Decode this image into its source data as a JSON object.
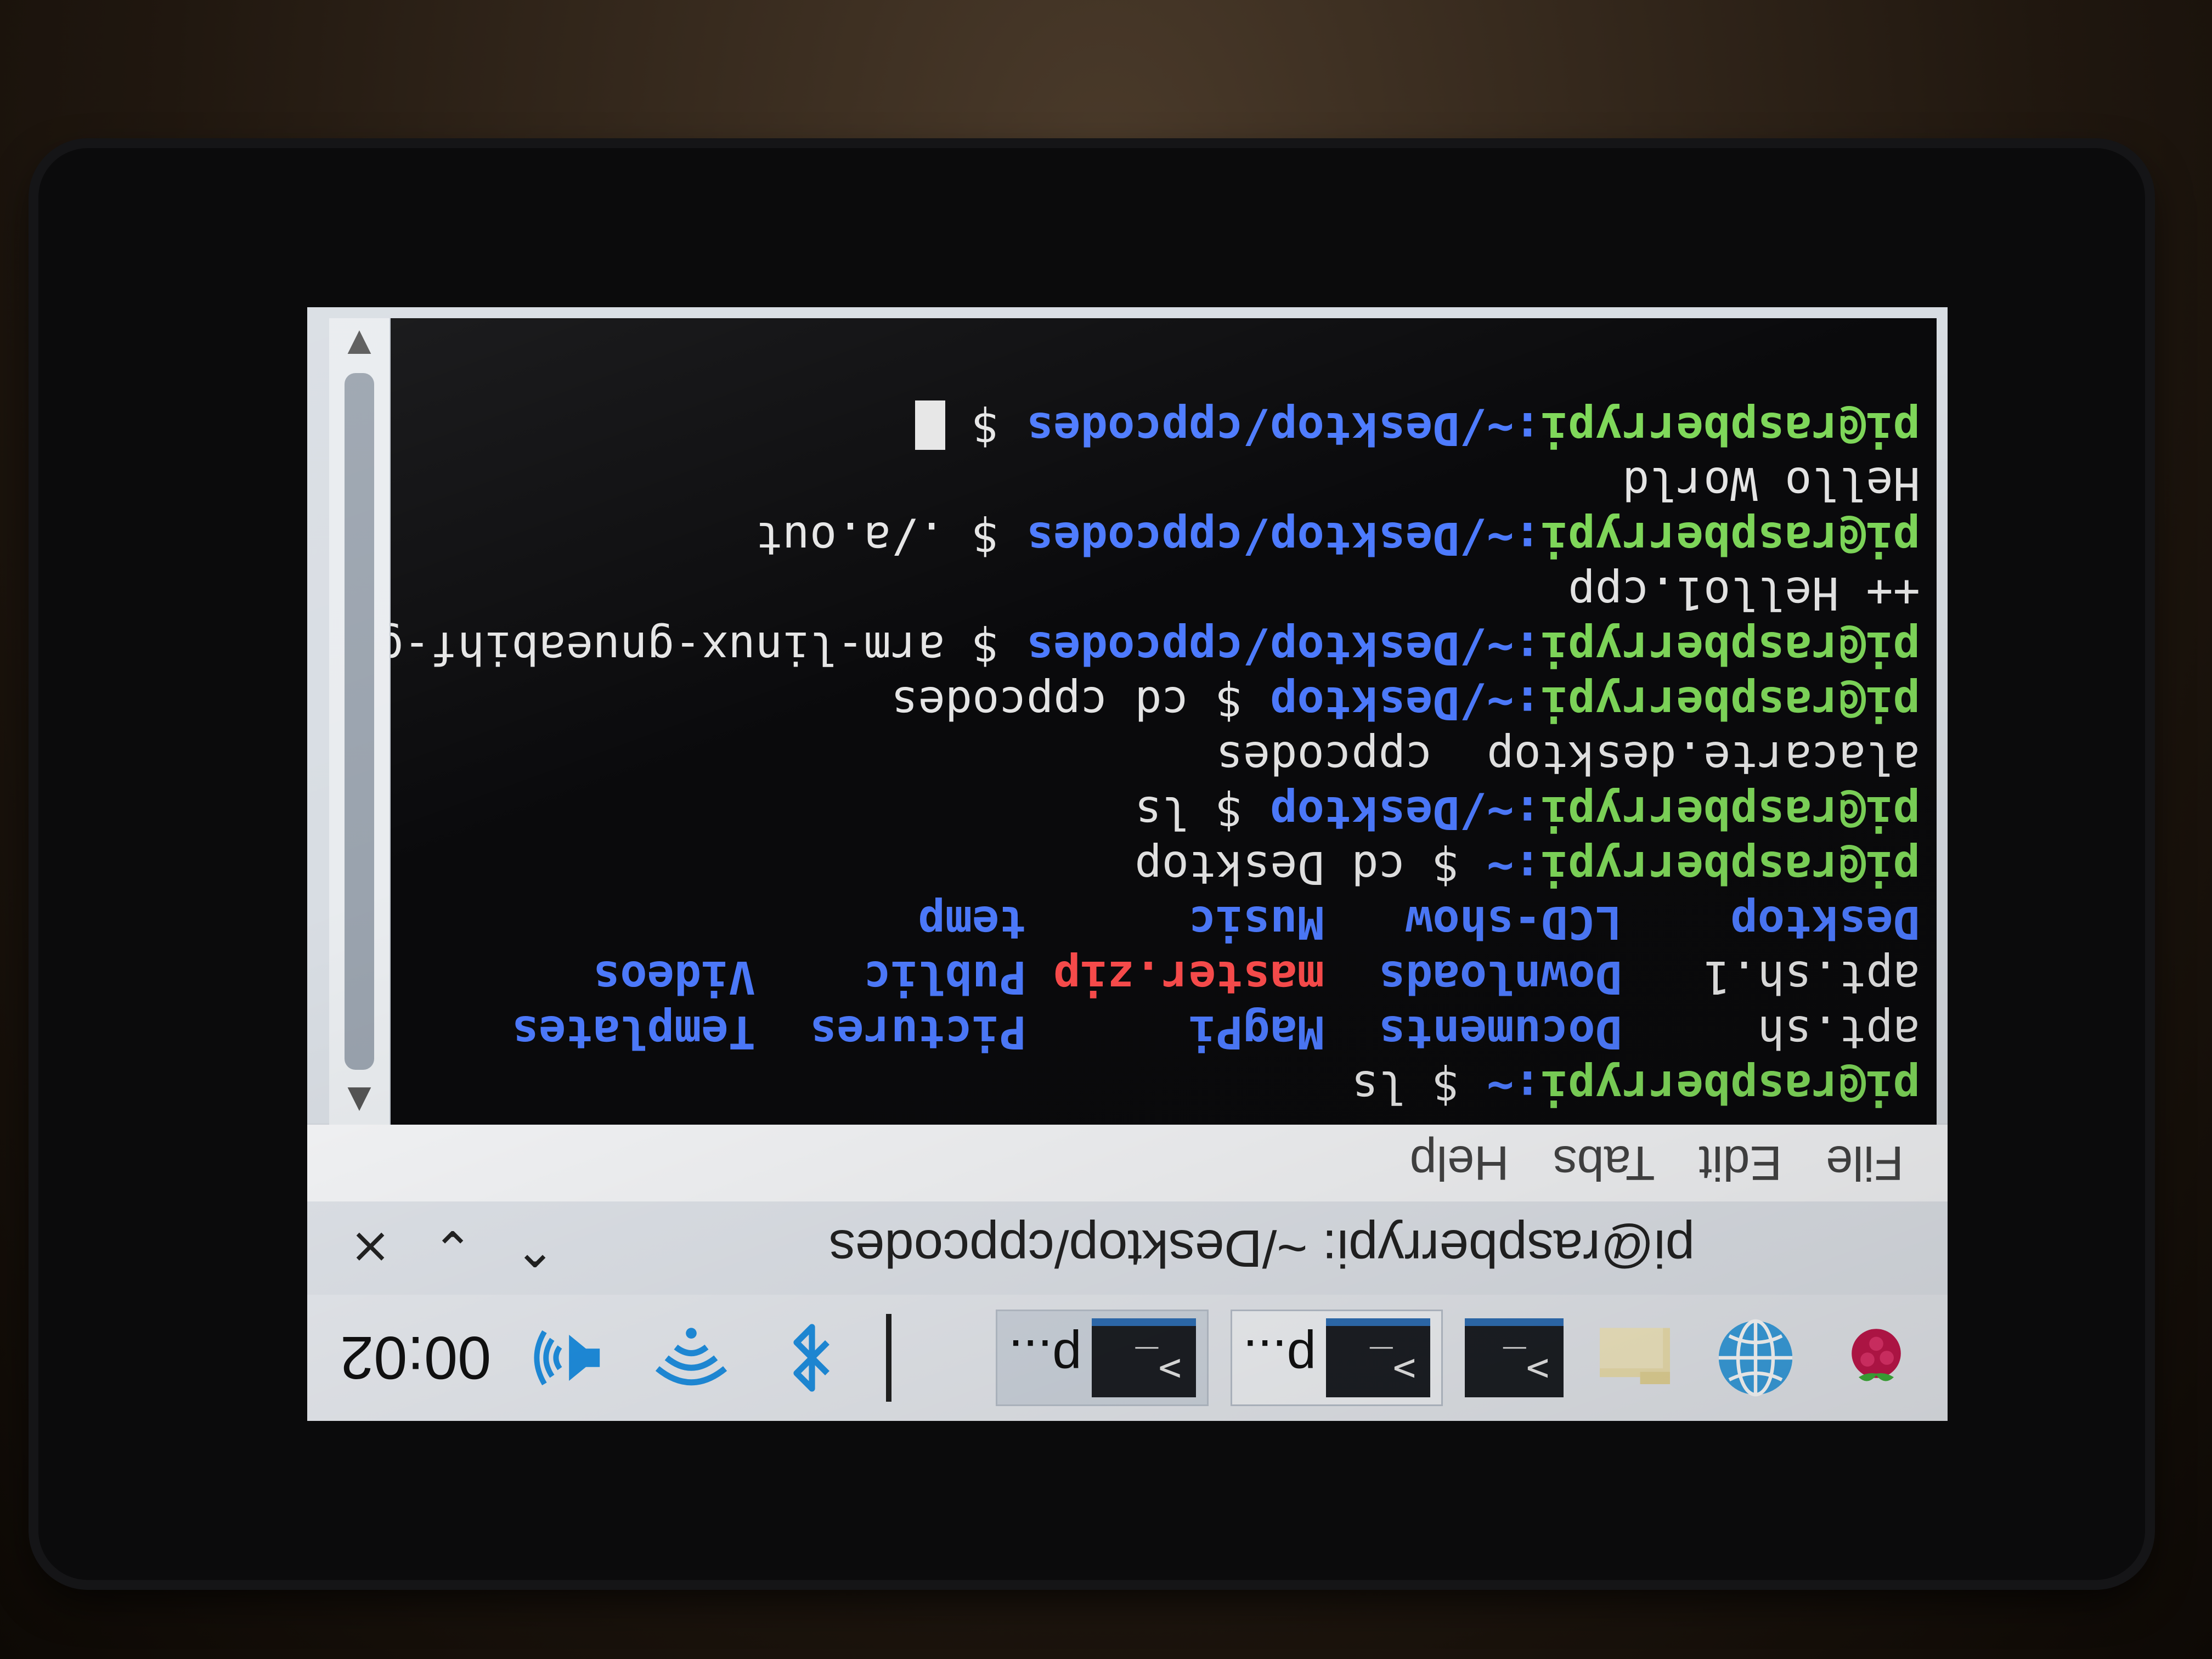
{
  "taskbar": {
    "items": [
      {
        "name": "raspberry-menu-icon"
      },
      {
        "name": "web-browser-icon"
      },
      {
        "name": "file-manager-icon"
      },
      {
        "name": "terminal-launcher-icon"
      }
    ],
    "windows": [
      {
        "label": "p..."
      },
      {
        "label": "p..."
      }
    ],
    "tray": {
      "bluetooth": "bluetooth-icon",
      "wifi": "wifi-icon",
      "volume": "volume-icon",
      "clock": "00:02"
    }
  },
  "window": {
    "title": "pi@raspberrypi: ~/Desktop/cppcodes",
    "buttons": {
      "minimize": "⌄",
      "maximize": "⌃",
      "close": "×"
    }
  },
  "menu": {
    "items": [
      "File",
      "Edit",
      "Tabs",
      "Help"
    ]
  },
  "terminal": {
    "lines": [
      {
        "user": "pi@raspberrypi",
        "path": ":~",
        "cmd": " $ ls"
      },
      {
        "listing": [
          "apt.sh     ",
          "Documents  ",
          "MagPi      ",
          "Pictures  ",
          "Templates"
        ]
      },
      {
        "listing": [
          "apt.sh.1   ",
          "Downloads  ",
          "master.zip ",
          "Public    ",
          "Videos"
        ]
      },
      {
        "listing": [
          "Desktop    ",
          "LCD-show   ",
          "Music      ",
          "temp"
        ]
      },
      {
        "user": "pi@raspberrypi",
        "path": ":~",
        "cmd": " $ cd Desktop"
      },
      {
        "user": "pi@raspberrypi",
        "path": ":~/Desktop",
        "cmd": " $ ls"
      },
      {
        "text": "alacarte.desktop  cppcodes"
      },
      {
        "user": "pi@raspberrypi",
        "path": ":~/Desktop",
        "cmd": " $ cd cppcodes"
      },
      {
        "user": "pi@raspberrypi",
        "path": ":~/Desktop/cppcodes",
        "cmd": " $ arm-linux-gnueabihf-g"
      },
      {
        "text": "++ Hello1.cpp"
      },
      {
        "user": "pi@raspberrypi",
        "path": ":~/Desktop/cppcodes",
        "cmd": " $ ./a.out"
      },
      {
        "text": "Hello World"
      },
      {
        "user": "pi@raspberrypi",
        "path": ":~/Desktop/cppcodes",
        "cmd": " $ "
      }
    ]
  },
  "colors": {
    "prompt_user": "#7fd85a",
    "prompt_path": "#4d7bff",
    "directory": "#4d7bff",
    "archive": "#ff4d4d",
    "terminal_bg": "#0a0a0c"
  }
}
